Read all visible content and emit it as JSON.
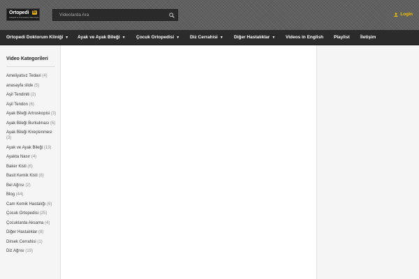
{
  "header": {
    "logo": {
      "text": "Ortopedi",
      "badge": "tv",
      "tagline": "Ortopedi ve Travmatoloji Video Arşivi"
    },
    "search": {
      "placeholder": "Videolarda Ara"
    },
    "login_label": "Login",
    "accent_color": "#f2c200"
  },
  "nav": {
    "items": [
      {
        "label": "Ortopedi Doktorum Kliniği",
        "dropdown": true
      },
      {
        "label": "Ayak ve Ayak Bileği",
        "dropdown": true
      },
      {
        "label": "Çocuk Ortopedisi",
        "dropdown": true
      },
      {
        "label": "Diz Cerrahisi",
        "dropdown": true
      },
      {
        "label": "Diğer Hastalıklar",
        "dropdown": true
      },
      {
        "label": "Videos in English",
        "dropdown": false
      },
      {
        "label": "Playlist",
        "dropdown": false
      },
      {
        "label": "İletişim",
        "dropdown": false
      }
    ]
  },
  "sidebar": {
    "title": "Video Kategorileri",
    "categories": [
      {
        "name": "Ameliyatsız Tedavi",
        "count": "(4)"
      },
      {
        "name": "anasayfa slide",
        "count": "(5)"
      },
      {
        "name": "Aşil Tendiniti",
        "count": "(2)"
      },
      {
        "name": "Aşil Tendon",
        "count": "(6)"
      },
      {
        "name": "Ayak Bileği Artroskopisi",
        "count": "(3)"
      },
      {
        "name": "Ayak Bileği Burkulması",
        "count": "(6)"
      },
      {
        "name": "Ayak Bileği Kireçlenmesi",
        "count": "(3)"
      },
      {
        "name": "Ayak ve Ayak Bileği",
        "count": "(13)"
      },
      {
        "name": "Ayakta Nasır",
        "count": "(4)"
      },
      {
        "name": "Baker Kisti",
        "count": "(6)"
      },
      {
        "name": "Basit Kemik Kisti",
        "count": "(8)"
      },
      {
        "name": "Bel Ağrısı",
        "count": "(2)"
      },
      {
        "name": "Blog",
        "count": "(44)"
      },
      {
        "name": "Cam Kemik Hastalığı",
        "count": "(6)"
      },
      {
        "name": "Çocuk Ortopedisi",
        "count": "(25)"
      },
      {
        "name": "Çocuklarda Aksama",
        "count": "(4)"
      },
      {
        "name": "Diğer Hastalıklar",
        "count": "(8)"
      },
      {
        "name": "Dirsek Cerrahisi",
        "count": "(1)"
      },
      {
        "name": "Diz Ağrısı",
        "count": "(19)"
      }
    ]
  }
}
